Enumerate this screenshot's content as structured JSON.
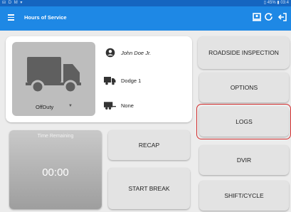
{
  "status_bar": {
    "left_icons": "⊟ D M ▾",
    "right_text": "▯ 45% ▮ 03:4"
  },
  "app_bar": {
    "title": "Hours of Service"
  },
  "vehicle_card": {
    "duty_status": "OffDuty",
    "driver_name": "John Doe Jr.",
    "vehicle": "Dodge 1",
    "trailer": "None"
  },
  "time_remaining": {
    "label": "Time Remaining",
    "value": "00:00"
  },
  "buttons": {
    "recap": "RECAP",
    "start_break": "START BREAK",
    "roadside_inspection": "ROADSIDE INSPECTION",
    "options": "OPTIONS",
    "logs": "LOGS",
    "dvir": "DVIR",
    "shift_cycle": "SHIFT/CYCLE"
  },
  "colors": {
    "app_bar": "#1e88e5",
    "status_bar": "#1565c0",
    "highlight": "#d32f2f"
  }
}
